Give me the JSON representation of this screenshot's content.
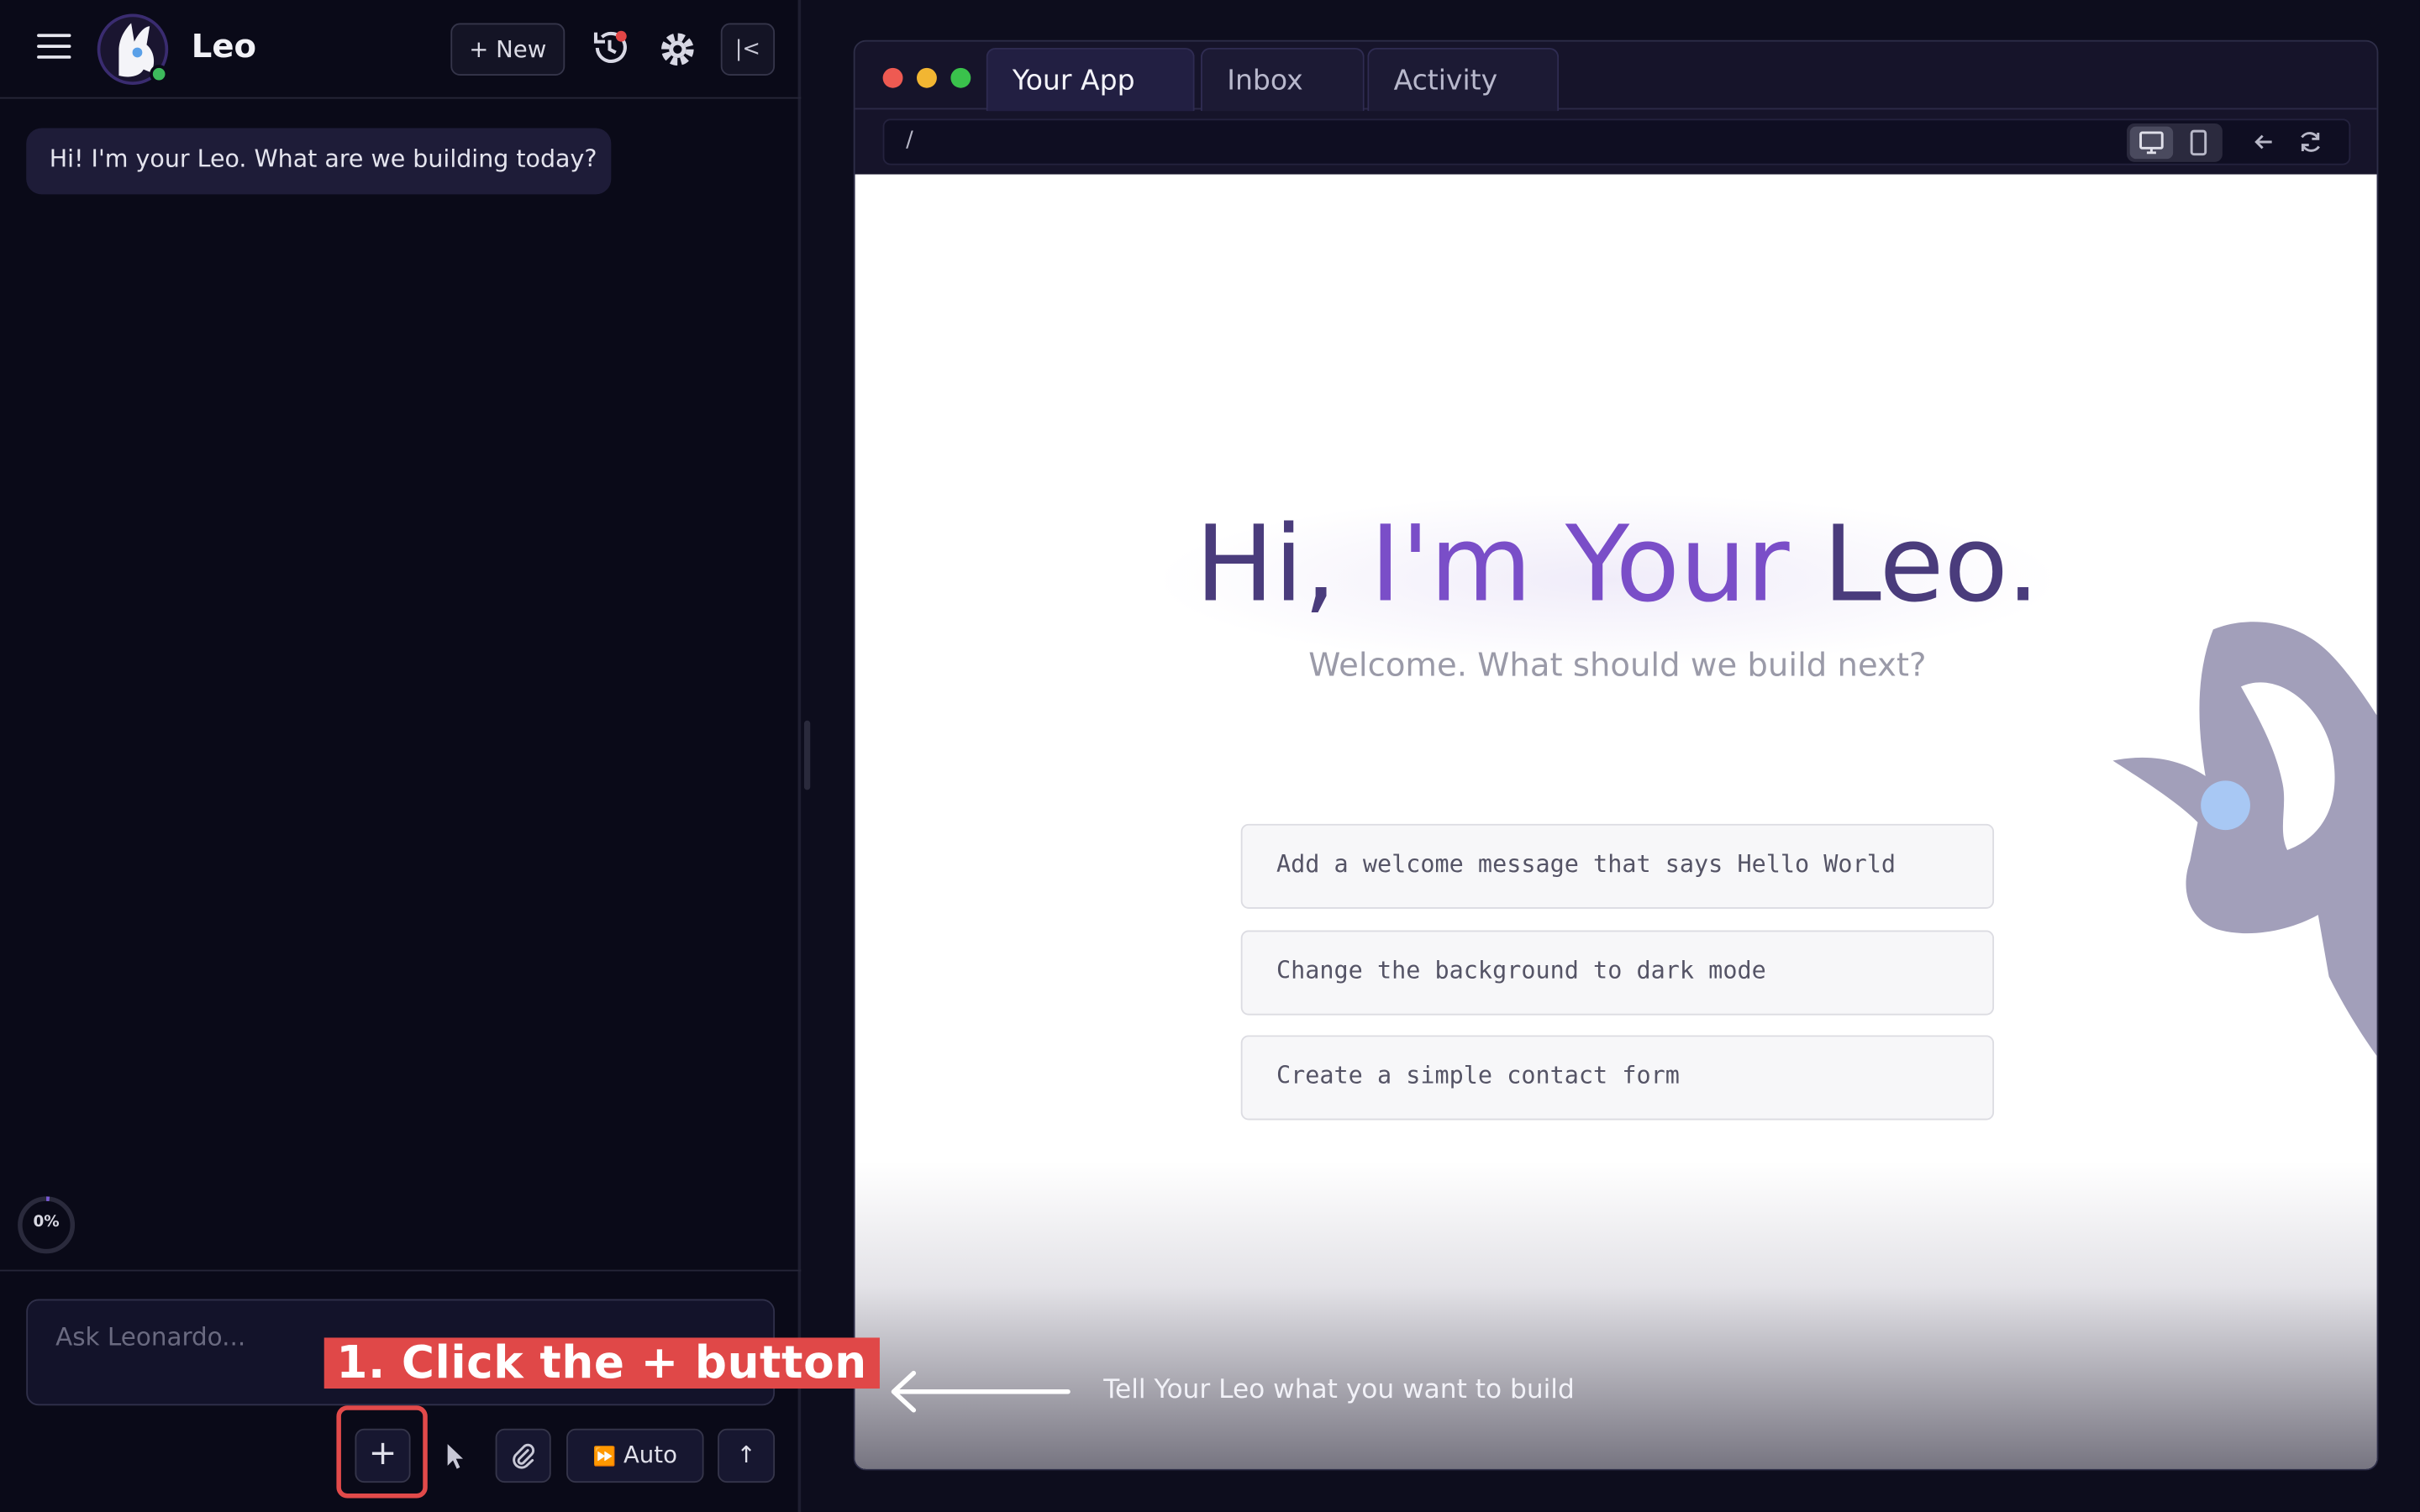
{
  "sidebar": {
    "brand": "Leo",
    "new_button": "+ New",
    "collapse_glyph": "|<",
    "greeting": "Hi! I'm your Leo. What are we building today?",
    "progress_label": "0%",
    "progress_value": 0,
    "input_placeholder": "Ask Leonardo...",
    "toolbar": {
      "plus_label": "+",
      "auto_label": "Auto",
      "send_glyph": "↑"
    },
    "icons": [
      "menu-icon",
      "logo-icon",
      "history-icon",
      "gear-icon",
      "collapse-icon",
      "cursor-icon",
      "paperclip-icon",
      "fast-forward-icon",
      "arrow-up-icon"
    ]
  },
  "annotation": {
    "callout": "1. Click the + button",
    "arrow_text": "Tell Your Leo what you want to build",
    "highlight_color": "#e24a4a"
  },
  "browser": {
    "tabs": [
      {
        "label": "Your App",
        "active": true
      },
      {
        "label": "Inbox",
        "active": false
      },
      {
        "label": "Activity",
        "active": false
      }
    ],
    "url": "/",
    "device_toggle": [
      "desktop-icon",
      "mobile-icon"
    ],
    "nav_icons": [
      "back-arrow-icon",
      "refresh-icon"
    ]
  },
  "app": {
    "title_part1": "Hi, ",
    "title_part2": "I'm Your ",
    "title_part3": "Leo.",
    "subtitle": "Welcome. What should we build next?",
    "suggestions": [
      "Add a welcome message that says Hello World",
      "Change the background to dark mode",
      "Create a simple contact form"
    ]
  },
  "colors": {
    "accent_purple": "#7a4ec8",
    "title_dark": "#4a3c7c",
    "status_online": "#3dba5c",
    "notification": "#e34646"
  }
}
